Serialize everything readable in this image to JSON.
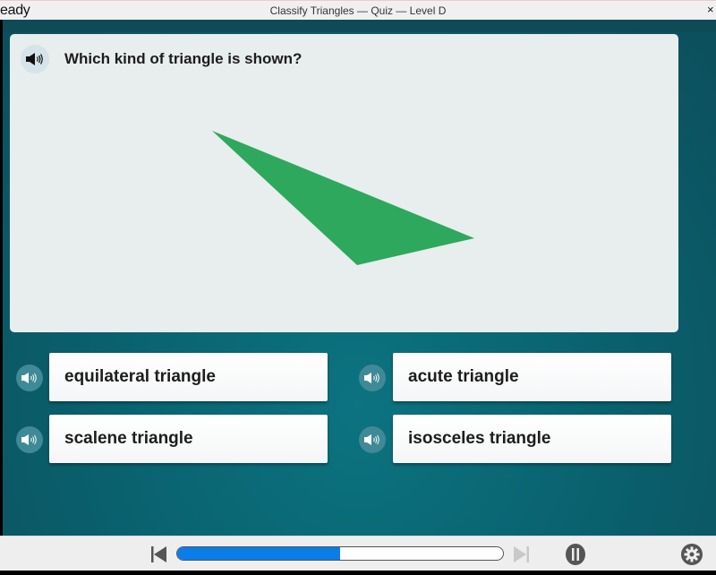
{
  "window": {
    "brand": "eady",
    "title": "Classify Triangles — Quiz — Level D",
    "close_label": "×"
  },
  "question": {
    "text": "Which kind of triangle is shown?",
    "audio_icon": "speaker-icon",
    "figure": {
      "shape": "triangle",
      "fill": "#2ea85c",
      "type_depicted": "scalene (obtuse)"
    }
  },
  "answers": [
    {
      "label": "equilateral triangle",
      "audio_icon": "speaker-icon"
    },
    {
      "label": "acute triangle",
      "audio_icon": "speaker-icon"
    },
    {
      "label": "scalene triangle",
      "audio_icon": "speaker-icon"
    },
    {
      "label": "isosceles triangle",
      "audio_icon": "speaker-icon"
    }
  ],
  "controls": {
    "progress_percent": 50,
    "progress_color": "#0a7de8",
    "prev_icon": "skip-back-icon",
    "next_icon": "skip-forward-icon",
    "pause_icon": "pause-icon",
    "settings_icon": "gear-icon"
  },
  "colors": {
    "stage_bg": "#0a6370",
    "card_bg": "#e8eded",
    "accent": "#0a7de8"
  }
}
